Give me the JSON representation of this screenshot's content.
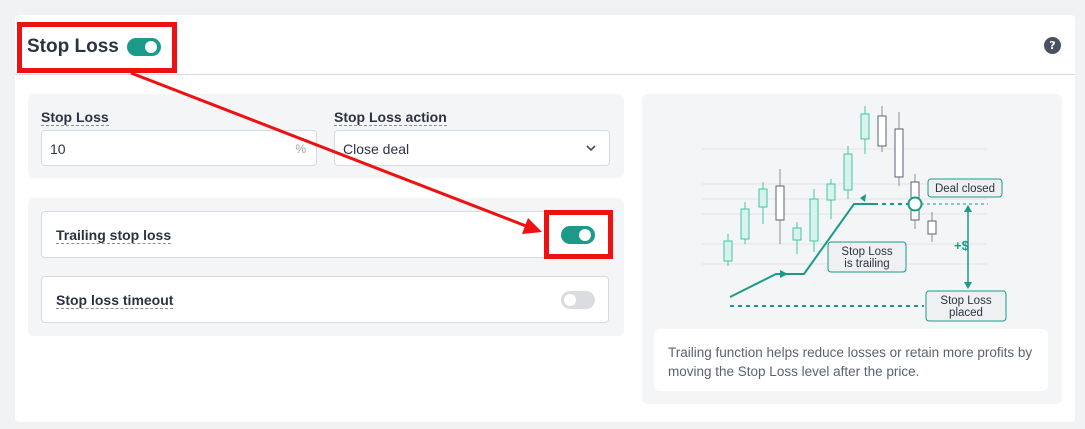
{
  "header": {
    "title": "Stop Loss",
    "help_icon": "?"
  },
  "stop_loss": {
    "label": "Stop Loss",
    "value": "10",
    "suffix": "%"
  },
  "stop_loss_action": {
    "label": "Stop Loss action",
    "value": "Close deal"
  },
  "trailing": {
    "label": "Trailing stop loss",
    "enabled": true
  },
  "timeout": {
    "label": "Stop loss timeout",
    "enabled": false
  },
  "illustration": {
    "deal_closed": "Deal closed",
    "trailing_line1": "Stop Loss",
    "trailing_line2": "is trailing",
    "profit": "+$",
    "placed_line1": "Stop Loss",
    "placed_line2": "placed",
    "description": "Trailing function helps reduce losses or retain more profits by moving the Stop Loss level after the price."
  },
  "colors": {
    "accent": "#1a9b8a",
    "highlight": "#ee1111"
  }
}
